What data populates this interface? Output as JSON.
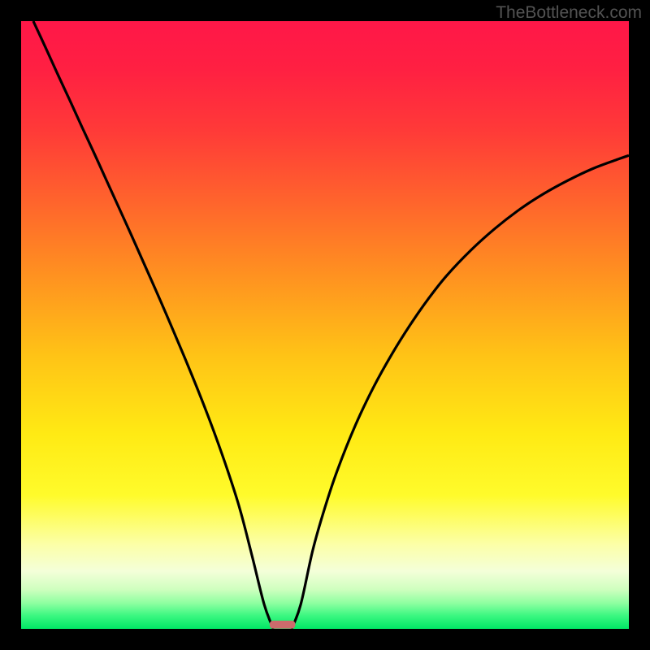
{
  "attribution": "TheBottleneck.com",
  "chart_data": {
    "type": "line",
    "title": "",
    "xlabel": "",
    "ylabel": "",
    "xlim": [
      0,
      100
    ],
    "ylim": [
      0,
      100
    ],
    "grid": false,
    "legend": false,
    "series": [
      {
        "name": "left-branch",
        "x": [
          2,
          4,
          6,
          8,
          10,
          12,
          14,
          16,
          18,
          20,
          22,
          24,
          26,
          28,
          30,
          32,
          34,
          36,
          38,
          40,
          41.5
        ],
        "values": [
          100,
          95.7,
          91.3,
          87.0,
          82.6,
          78.3,
          73.9,
          69.5,
          65.1,
          60.6,
          56.1,
          51.5,
          46.8,
          42.0,
          37.0,
          31.7,
          26.0,
          19.7,
          12.0,
          4.0,
          0
        ]
      },
      {
        "name": "right-branch",
        "x": [
          44.5,
          46,
          48,
          50,
          52,
          55,
          58,
          61,
          64,
          67,
          70,
          74,
          78,
          82,
          86,
          90,
          94,
          98,
          100
        ],
        "values": [
          0,
          4.0,
          13.0,
          20.0,
          26.0,
          33.5,
          39.8,
          45.2,
          50.0,
          54.3,
          58.1,
          62.3,
          65.9,
          69.0,
          71.6,
          73.8,
          75.7,
          77.2,
          77.9
        ]
      }
    ],
    "marker": {
      "x_center": 43,
      "y": 0.7,
      "width": 4.2,
      "height": 1.3,
      "color": "#cc6b6c"
    },
    "background_gradient": {
      "stops": [
        {
          "offset": 0.0,
          "color": "#ff1748"
        },
        {
          "offset": 0.08,
          "color": "#ff2042"
        },
        {
          "offset": 0.18,
          "color": "#ff3a38"
        },
        {
          "offset": 0.3,
          "color": "#ff652c"
        },
        {
          "offset": 0.42,
          "color": "#ff9220"
        },
        {
          "offset": 0.55,
          "color": "#ffc316"
        },
        {
          "offset": 0.68,
          "color": "#ffea14"
        },
        {
          "offset": 0.78,
          "color": "#fffb2b"
        },
        {
          "offset": 0.86,
          "color": "#fcffa6"
        },
        {
          "offset": 0.905,
          "color": "#f4ffd9"
        },
        {
          "offset": 0.935,
          "color": "#cfffbf"
        },
        {
          "offset": 0.958,
          "color": "#8dffa0"
        },
        {
          "offset": 0.978,
          "color": "#3cf781"
        },
        {
          "offset": 1.0,
          "color": "#00e765"
        }
      ]
    }
  }
}
